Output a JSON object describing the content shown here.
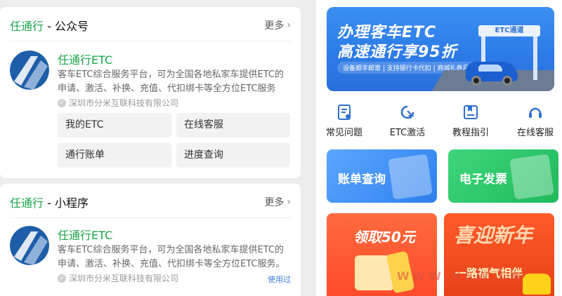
{
  "left": {
    "card1": {
      "brand": "任通行",
      "suffix": " - 公众号",
      "more": "更多",
      "app_name": "任通行ETC",
      "desc": "客车ETC综合服务平台，可为全国各地私家车提供ETC的申请、激活、补换、充值、代扣绑卡等全方位ETC服务",
      "company": "深圳市分米互联科技有限公司",
      "menu": [
        "我的ETC",
        "在线客服",
        "通行账单",
        "进度查询"
      ]
    },
    "card2": {
      "brand": "任通行",
      "suffix": " - 小程序",
      "more": "更多",
      "app_name": "任通行ETC",
      "desc": "客车ETC综合服务平台，可为全国各地私家车提供ETC的申请、激活、补换、充值、代扣绑卡等全方位ETC服务。",
      "company": "深圳市分米互联科技有限公司",
      "used": "使用过"
    }
  },
  "right": {
    "banner": {
      "line1": "办理客车ETC",
      "line2": "高速通行享95折",
      "sub": "设备顺丰邮寄 | 支持银行卡代扣 | 商城礼券月月领",
      "gantry": "ETC通道"
    },
    "quick": [
      {
        "label": "常见问题",
        "icon": "faq-icon"
      },
      {
        "label": "ETC激活",
        "icon": "activate-icon"
      },
      {
        "label": "教程指引",
        "icon": "guide-icon"
      },
      {
        "label": "在线客服",
        "icon": "support-icon"
      }
    ],
    "tiles": {
      "bill": "账单查询",
      "invoice": "电子发票"
    },
    "promo1": "领取50元",
    "promo2": {
      "title": "喜迎新年",
      "slogan": "一路福气相伴"
    },
    "watermark": "WWW.HSW.CN"
  },
  "colors": {
    "brand_green": "#19a44a",
    "link_blue": "#3a7be0"
  }
}
